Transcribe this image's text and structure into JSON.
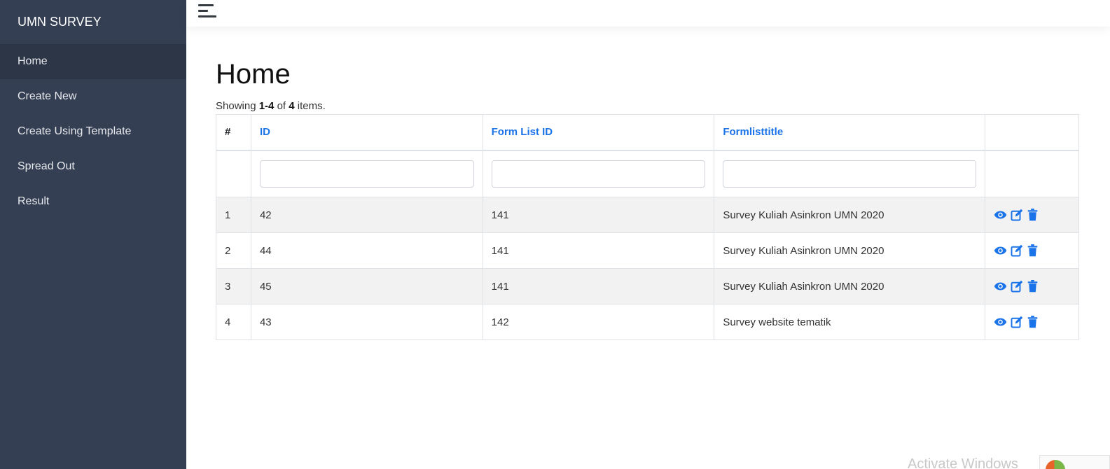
{
  "sidebar": {
    "brand": "UMN SURVEY",
    "items": [
      {
        "label": "Home",
        "active": true
      },
      {
        "label": "Create New"
      },
      {
        "label": "Create Using Template"
      },
      {
        "label": "Spread Out"
      },
      {
        "label": "Result"
      }
    ]
  },
  "topbar": {
    "menu_icon": "hamburger-icon"
  },
  "main": {
    "title": "Home",
    "summary": {
      "prefix": "Showing",
      "range": "1-4",
      "of": "of",
      "total": "4",
      "suffix": "items."
    }
  },
  "table": {
    "headers": [
      "#",
      "ID",
      "Form List ID",
      "Formlisttitle",
      ""
    ],
    "filters": {
      "id": "",
      "form_list_id": "",
      "formlisttitle": ""
    },
    "rows": [
      {
        "num": "1",
        "id": "42",
        "form_list_id": "141",
        "title": "Survey Kuliah Asinkron UMN 2020"
      },
      {
        "num": "2",
        "id": "44",
        "form_list_id": "141",
        "title": "Survey Kuliah Asinkron UMN 2020"
      },
      {
        "num": "3",
        "id": "45",
        "form_list_id": "141",
        "title": "Survey Kuliah Asinkron UMN 2020"
      },
      {
        "num": "4",
        "id": "43",
        "form_list_id": "142",
        "title": "Survey website tematik"
      }
    ],
    "action_icons": [
      "eye-icon",
      "edit-icon",
      "trash-icon"
    ],
    "action_color": "#1a73e8"
  },
  "overlay": {
    "watermark": "Activate Windows"
  }
}
